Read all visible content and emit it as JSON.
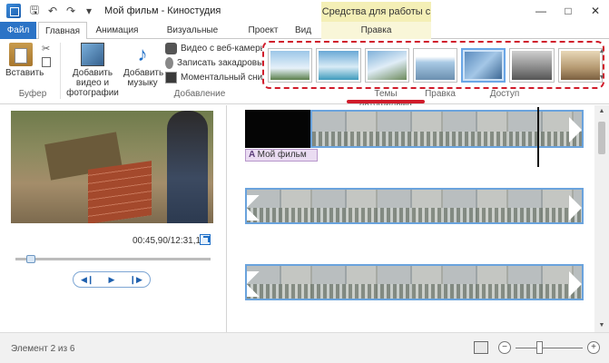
{
  "window": {
    "title": "Мой фильм - Киностудия",
    "context_group": "Средства для работы с видео",
    "controls": [
      "—",
      "□",
      "✕"
    ]
  },
  "tabs": {
    "file": "Файл",
    "home": "Главная",
    "animation": "Анимация",
    "visual_effects": "Визуальные эффекты",
    "project": "Проект",
    "view": "Вид",
    "edit": "Правка"
  },
  "ribbon": {
    "clipboard": {
      "paste": "Вставить",
      "label": "Буфер"
    },
    "add": {
      "add_video": "Добавить видео и фотографии",
      "add_music": "Добавить музыку",
      "webcam": "Видео с веб-камеры",
      "voiceover": "Записать закадровый",
      "snapshot": "Моментальный снимок",
      "label": "Добавление"
    },
    "themes_label": "Темы автофильма",
    "edit_label": "Правка",
    "share_label": "Доступ"
  },
  "preview": {
    "timecode": "00:45,90/12:31,17",
    "seek_fraction": 0.06
  },
  "timeline": {
    "caption": "Мой фильм"
  },
  "status": {
    "text": "Элемент 2 из 6",
    "zoom_fraction": 0.35
  },
  "colors": {
    "accent": "#2b73c6",
    "highlight": "#d01c2b",
    "context_tab": "#f4efb6"
  }
}
